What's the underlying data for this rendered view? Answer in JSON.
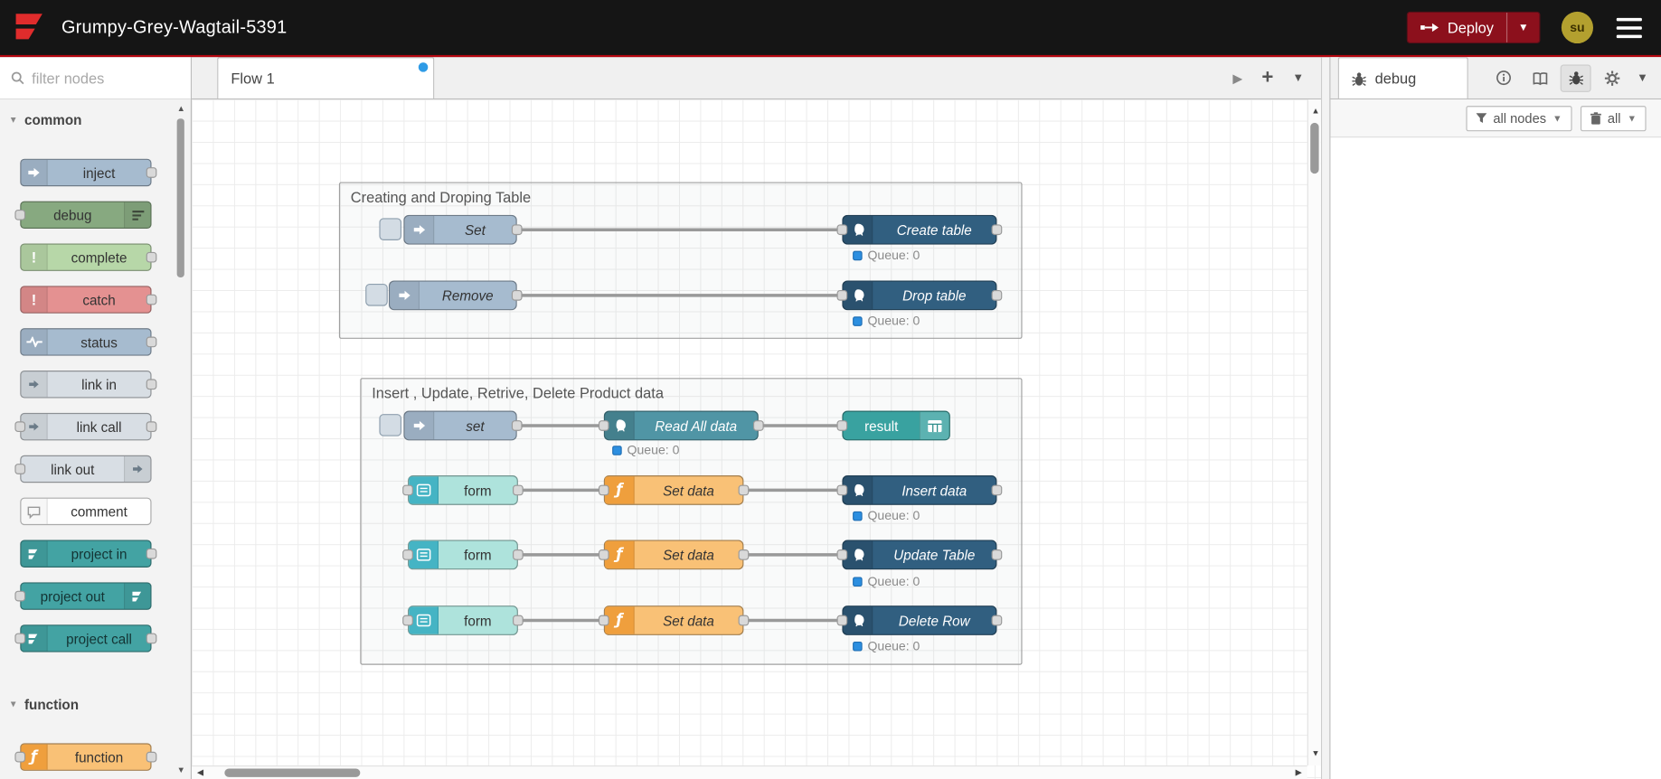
{
  "header": {
    "title": "Grumpy-Grey-Wagtail-5391",
    "deploy_label": "Deploy",
    "user_initials": "su"
  },
  "palette": {
    "filter_placeholder": "filter nodes",
    "categories": {
      "common": "common",
      "function": "function"
    },
    "nodes": {
      "inject": "inject",
      "debug": "debug",
      "complete": "complete",
      "catch": "catch",
      "status": "status",
      "link_in": "link in",
      "link_call": "link call",
      "link_out": "link out",
      "comment": "comment",
      "project_in": "project in",
      "project_out": "project out",
      "project_call": "project call",
      "function": "function"
    }
  },
  "workspace": {
    "tab": "Flow 1",
    "groups": [
      {
        "label": "Creating and Droping Table",
        "nodes": {
          "set": "Set",
          "create_table": "Create table",
          "remove": "Remove",
          "drop_table": "Drop table"
        }
      },
      {
        "label": "Insert , Update, Retrive, Delete Product data",
        "nodes": {
          "set": "set",
          "read_all": "Read All data",
          "result": "result",
          "form": "form",
          "set_data": "Set data",
          "insert_data": "Insert data",
          "update_table": "Update Table",
          "delete_row": "Delete Row"
        }
      }
    ],
    "queue_status": "Queue: 0"
  },
  "sidebar": {
    "debug_tab": "debug",
    "filter_button": "all nodes",
    "clear_button": "all"
  },
  "colors": {
    "deploy_button": "#8C101C",
    "header_accent": "#b40710",
    "inject": "#a6bbcf",
    "debug": "#87a980",
    "complete": "#b7d7a8",
    "catch": "#e49191",
    "status_node": "#a6bbcf",
    "link": "#d8dee4",
    "comment": "#ffffff",
    "project": "#43a3a3",
    "function": "#f9c176",
    "postgres": "#315f80",
    "postgres_teal": "#5095a5",
    "result": "#39a2a0",
    "form": "#aee3dc",
    "status_dot": "#2d8fe0",
    "tab_dirty_dot": "#2e9be6"
  }
}
